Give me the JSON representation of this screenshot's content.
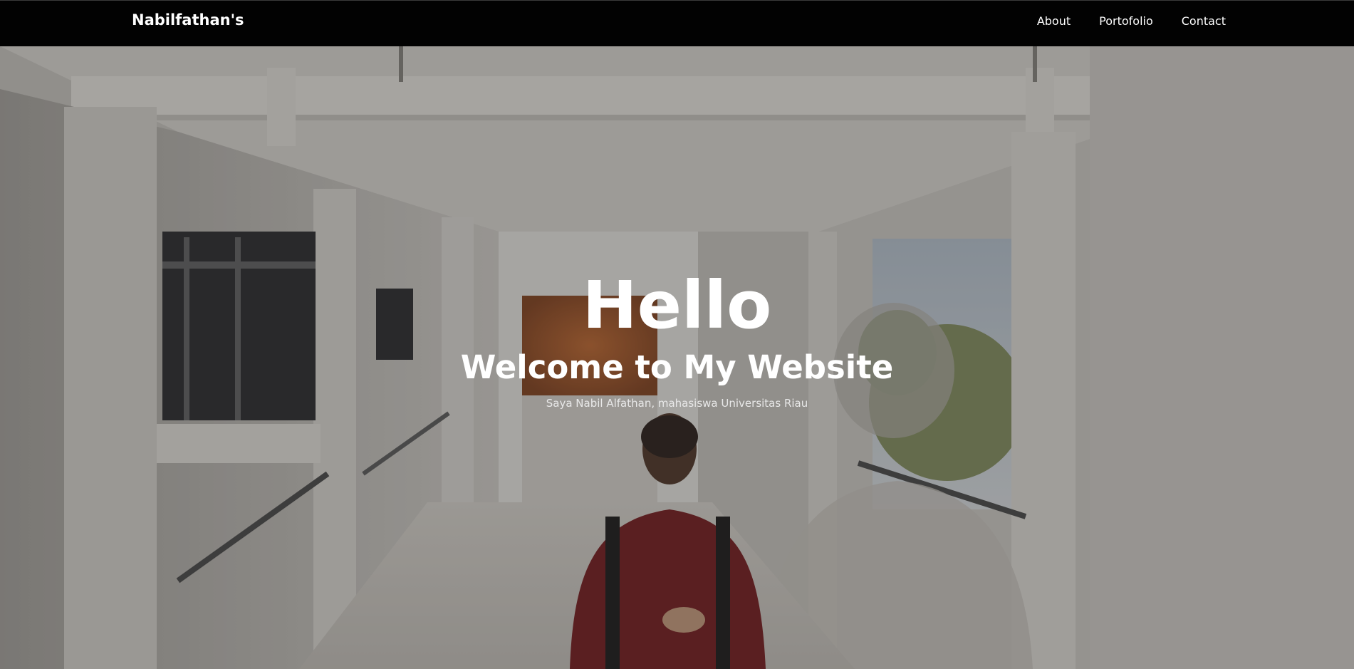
{
  "navbar": {
    "brand": "Nabilfathan's",
    "links": [
      {
        "label": "About"
      },
      {
        "label": "Portofolio"
      },
      {
        "label": "Contact"
      }
    ]
  },
  "hero": {
    "heading": "Hello",
    "subheading": "Welcome to My Website",
    "tagline": "Saya Nabil Alfathan, mahasiswa Universitas Riau"
  },
  "colors": {
    "navbar_bg": "#020202",
    "text": "#ffffff"
  }
}
